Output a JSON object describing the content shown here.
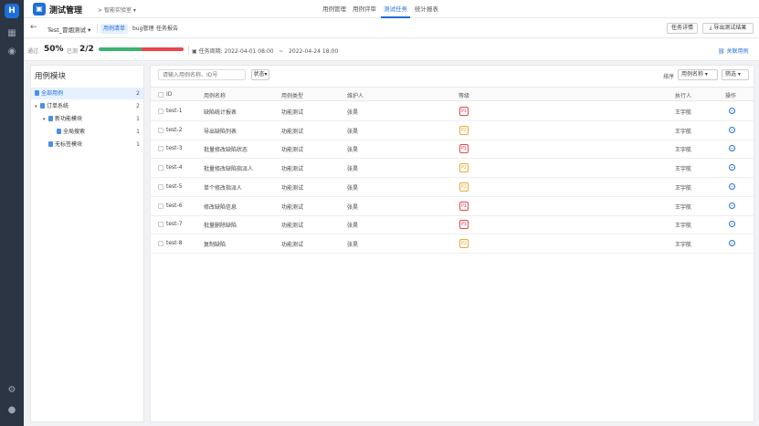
{
  "app": {
    "title": "测试管理",
    "project": "智能实验室",
    "nav": [
      "用例管理",
      "用例评审",
      "测试任务",
      "统计报表"
    ],
    "active_nav": "测试任务"
  },
  "subheader": {
    "task_name": "Test_冒烟测试",
    "tabs": [
      "用例清单",
      "bug管理",
      "任务报告"
    ],
    "active_tab": "用例清单",
    "btn_detail": "任务详情",
    "btn_export": "导出测试结果"
  },
  "stats": {
    "pass_label": "通过",
    "pass_value": "50%",
    "done_label": "已测",
    "done_value": "2/2",
    "progress_pass_fraction": 0.5,
    "progress_fail_fraction": 0.5,
    "period_label": "任务周期:",
    "period_start": "2022-04-01 08:00",
    "period_sep": "~",
    "period_end": "2022-04-24 18:00",
    "link_label": "关联用例"
  },
  "tree": {
    "title": "用例模块",
    "items": [
      {
        "label": "全部用例",
        "count": "2"
      },
      {
        "label": "订单系统",
        "count": "2"
      },
      {
        "label": "新功能模块",
        "count": "1"
      },
      {
        "label": "全局搜索",
        "count": "1"
      },
      {
        "label": "无标签模块",
        "count": "1"
      }
    ]
  },
  "toolbar": {
    "search_placeholder": "请输入用例名称、ID号",
    "status_label": "状态",
    "sort_label": "排序",
    "sort_value": "用例名称",
    "filter_label": "筛选"
  },
  "table": {
    "headers": [
      "ID",
      "用例名称",
      "用例类型",
      "维护人",
      "等级",
      "执行人",
      "操作"
    ],
    "rows": [
      {
        "id": "test-1",
        "name": "缺陷统计报表",
        "type": "功能测试",
        "owner": "张昊",
        "level": "P1",
        "executor": "王宇航"
      },
      {
        "id": "test-2",
        "name": "导出缺陷列表",
        "type": "功能测试",
        "owner": "张昊",
        "level": "P2",
        "executor": "王宇航"
      },
      {
        "id": "test-3",
        "name": "批量修改缺陷状态",
        "type": "功能测试",
        "owner": "张昊",
        "level": "P1",
        "executor": "王宇航"
      },
      {
        "id": "test-4",
        "name": "批量修改缺陷指派人",
        "type": "功能测试",
        "owner": "张昊",
        "level": "P2",
        "executor": "王宇航"
      },
      {
        "id": "test-5",
        "name": "单个修改指派人",
        "type": "功能测试",
        "owner": "张昊",
        "level": "P2",
        "executor": "王宇航"
      },
      {
        "id": "test-6",
        "name": "修改缺陷信息",
        "type": "功能测试",
        "owner": "张昊",
        "level": "P1",
        "executor": "王宇航"
      },
      {
        "id": "test-7",
        "name": "批量删除缺陷",
        "type": "功能测试",
        "owner": "张昊",
        "level": "P1",
        "executor": "王宇航"
      },
      {
        "id": "test-8",
        "name": "复制缺陷",
        "type": "功能测试",
        "owner": "张昊",
        "level": "P2",
        "executor": "王宇航"
      }
    ]
  },
  "colors": {
    "accent": "#1f6fd8",
    "p1": "#e8474b",
    "p2": "#f0a830",
    "pass": "#3cb371",
    "fail": "#e8474b"
  }
}
